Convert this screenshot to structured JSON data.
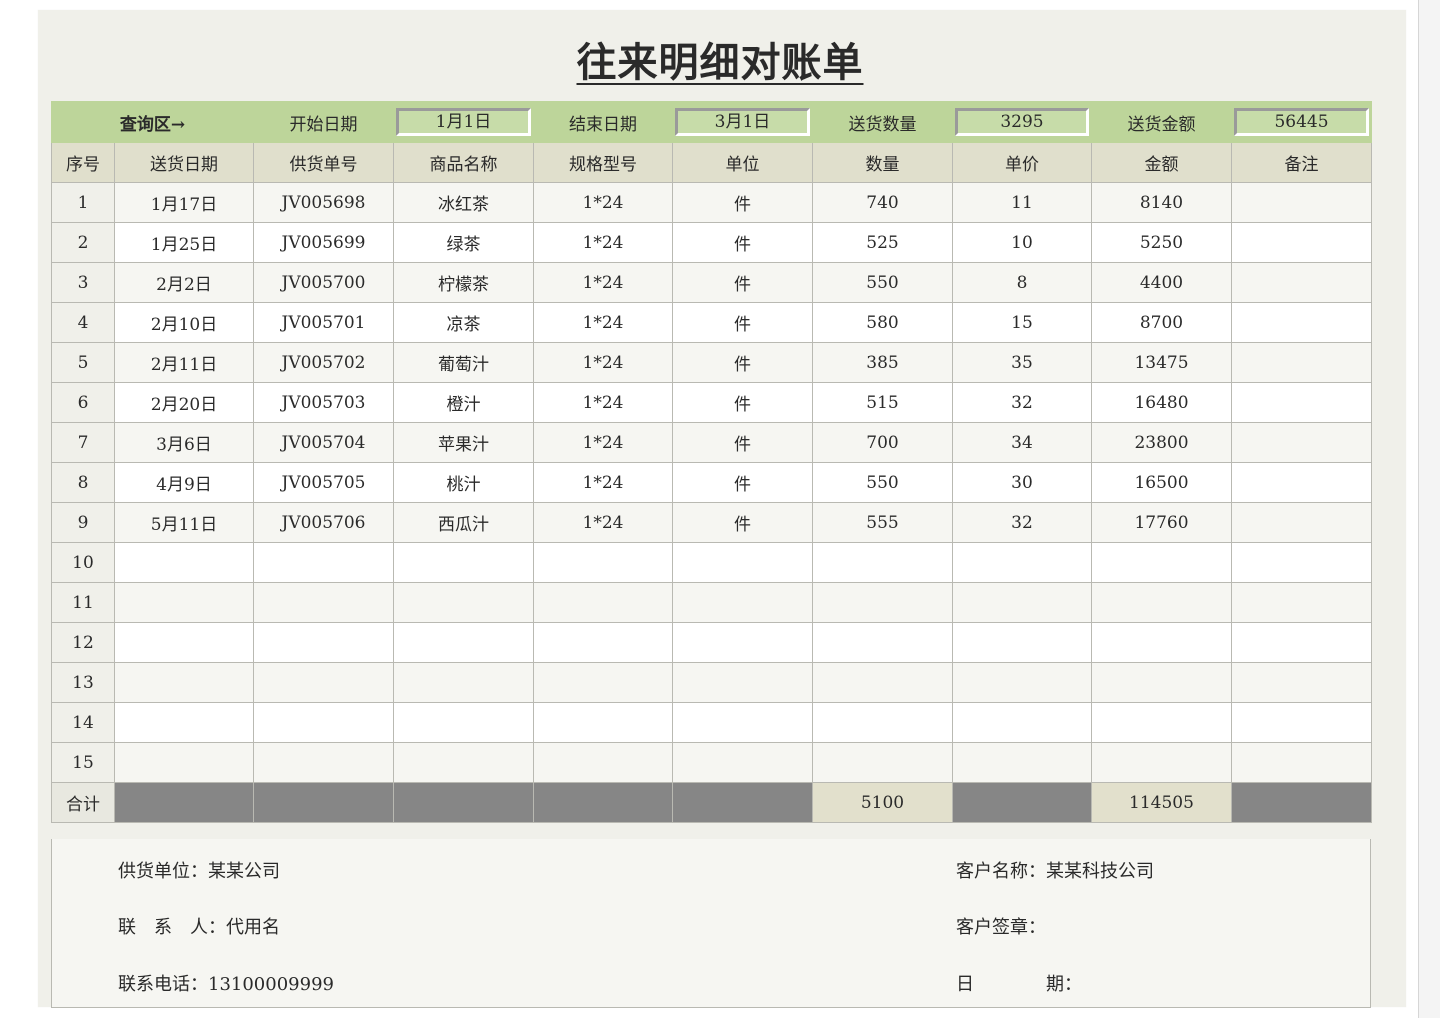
{
  "title": "往来明细对账单",
  "query": {
    "label": "查询区→",
    "start_label": "开始日期",
    "start_value": "1月1日",
    "end_label": "结束日期",
    "end_value": "3月1日",
    "qty_label": "送货数量",
    "qty_value": "3295",
    "amount_label": "送货金额",
    "amount_value": "56445"
  },
  "columns": [
    "序号",
    "送货日期",
    "供货单号",
    "商品名称",
    "规格型号",
    "单位",
    "数量",
    "单价",
    "金额",
    "备注"
  ],
  "rows": [
    [
      "1",
      "1月17日",
      "JV005698",
      "冰红茶",
      "1*24",
      "件",
      "740",
      "11",
      "8140",
      ""
    ],
    [
      "2",
      "1月25日",
      "JV005699",
      "绿茶",
      "1*24",
      "件",
      "525",
      "10",
      "5250",
      ""
    ],
    [
      "3",
      "2月2日",
      "JV005700",
      "柠檬茶",
      "1*24",
      "件",
      "550",
      "8",
      "4400",
      ""
    ],
    [
      "4",
      "2月10日",
      "JV005701",
      "凉茶",
      "1*24",
      "件",
      "580",
      "15",
      "8700",
      ""
    ],
    [
      "5",
      "2月11日",
      "JV005702",
      "葡萄汁",
      "1*24",
      "件",
      "385",
      "35",
      "13475",
      ""
    ],
    [
      "6",
      "2月20日",
      "JV005703",
      "橙汁",
      "1*24",
      "件",
      "515",
      "32",
      "16480",
      ""
    ],
    [
      "7",
      "3月6日",
      "JV005704",
      "苹果汁",
      "1*24",
      "件",
      "700",
      "34",
      "23800",
      ""
    ],
    [
      "8",
      "4月9日",
      "JV005705",
      "桃汁",
      "1*24",
      "件",
      "550",
      "30",
      "16500",
      ""
    ],
    [
      "9",
      "5月11日",
      "JV005706",
      "西瓜汁",
      "1*24",
      "件",
      "555",
      "32",
      "17760",
      ""
    ],
    [
      "10",
      "",
      "",
      "",
      "",
      "",
      "",
      "",
      "",
      ""
    ],
    [
      "11",
      "",
      "",
      "",
      "",
      "",
      "",
      "",
      "",
      ""
    ],
    [
      "12",
      "",
      "",
      "",
      "",
      "",
      "",
      "",
      "",
      ""
    ],
    [
      "13",
      "",
      "",
      "",
      "",
      "",
      "",
      "",
      "",
      ""
    ],
    [
      "14",
      "",
      "",
      "",
      "",
      "",
      "",
      "",
      "",
      ""
    ],
    [
      "15",
      "",
      "",
      "",
      "",
      "",
      "",
      "",
      "",
      ""
    ]
  ],
  "total": {
    "label": "合计",
    "qty": "5100",
    "amount": "114505"
  },
  "footer": {
    "supplier": "供货单位：某某公司",
    "contact": "联　系　人：代用名",
    "phone": "联系电话：13100009999",
    "customer": "客户名称：某某科技公司",
    "signature": "客户签章：",
    "date": "日　　　　期："
  }
}
